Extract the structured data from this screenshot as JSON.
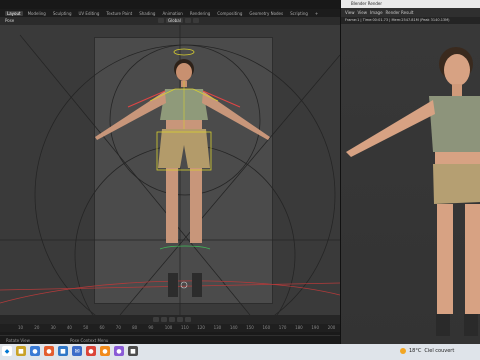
{
  "blender": {
    "workspace_tabs": [
      "Layout",
      "Modeling",
      "Sculpting",
      "UV Editing",
      "Texture Paint",
      "Shading",
      "Animation",
      "Rendering",
      "Compositing",
      "Geometry Nodes",
      "Scripting",
      "+"
    ],
    "active_tab": "Layout",
    "mode": "Pose",
    "orientation": "Global",
    "timeline": {
      "frames": [
        "10",
        "20",
        "30",
        "40",
        "50",
        "60",
        "70",
        "80",
        "90",
        "100",
        "110",
        "120",
        "130",
        "140",
        "150",
        "160",
        "170",
        "180",
        "190",
        "200"
      ]
    },
    "status_left": "Rotate View",
    "status_mid": "Pose Context Menu"
  },
  "render_window": {
    "title": "Blender Render",
    "menu": [
      "View",
      "View",
      "Image",
      "Render Result"
    ],
    "info": "Frame:1 | Time:00:01.73 | Mem:2547.81M (Peak 3140.13M)"
  },
  "taskbar": {
    "weather_temp": "18°C",
    "weather_desc": "Ciel couvert"
  },
  "colors": {
    "bone_yellow": "#d8cf2f",
    "bone_red": "#e04545",
    "armature_green": "#3fbf5a",
    "skin": "#d8a07a",
    "shirt": "#8f9a7a",
    "shorts": "#b39b6a"
  }
}
